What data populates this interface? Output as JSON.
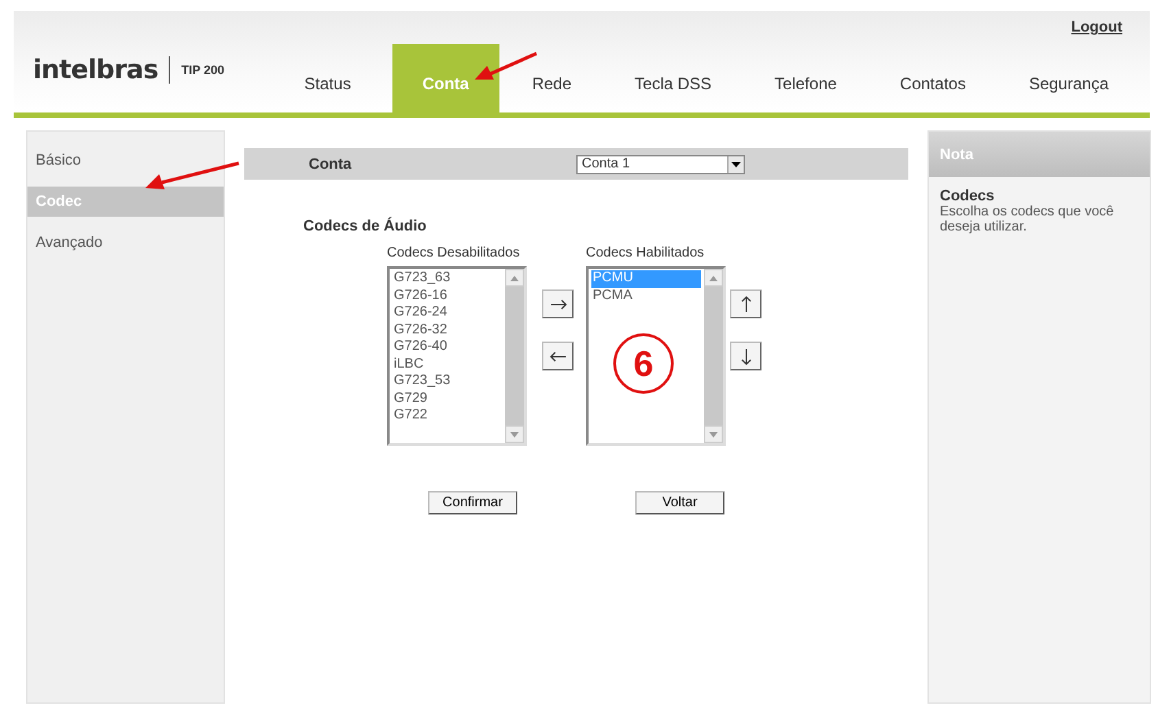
{
  "header": {
    "logo": "intelbras",
    "model": "TIP 200",
    "logout": "Logout"
  },
  "tabs": [
    {
      "label": "Status",
      "selected": false
    },
    {
      "label": "Conta",
      "selected": true
    },
    {
      "label": "Rede",
      "selected": false
    },
    {
      "label": "Tecla DSS",
      "selected": false
    },
    {
      "label": "Telefone",
      "selected": false
    },
    {
      "label": "Contatos",
      "selected": false
    },
    {
      "label": "Segurança",
      "selected": false
    }
  ],
  "sidebar": {
    "items": [
      {
        "label": "Básico",
        "selected": false
      },
      {
        "label": "Codec",
        "selected": true
      },
      {
        "label": "Avançado",
        "selected": false
      }
    ]
  },
  "account_bar": {
    "label": "Conta",
    "select_value": "Conta 1"
  },
  "audio_codecs": {
    "title": "Codecs de Áudio",
    "disabled_list": {
      "label": "Codecs Desabilitados",
      "items": [
        {
          "label": "G723_63",
          "selected": false
        },
        {
          "label": "G726-16",
          "selected": false
        },
        {
          "label": "G726-24",
          "selected": false
        },
        {
          "label": "G726-32",
          "selected": false
        },
        {
          "label": "G726-40",
          "selected": false
        },
        {
          "label": "iLBC",
          "selected": false
        },
        {
          "label": "G723_53",
          "selected": false
        },
        {
          "label": "G729",
          "selected": false
        },
        {
          "label": "G722",
          "selected": false
        }
      ]
    },
    "enabled_list": {
      "label": "Codecs Habilitados",
      "items": [
        {
          "label": "PCMU",
          "selected": true
        },
        {
          "label": "PCMA",
          "selected": false
        }
      ]
    }
  },
  "actions": [
    "Confirmar",
    "Voltar"
  ],
  "note": {
    "title": "Nota",
    "heading": "Codecs",
    "text": "Escolha os codecs que você deseja utilizar."
  },
  "annotation": {
    "callout": "6"
  }
}
